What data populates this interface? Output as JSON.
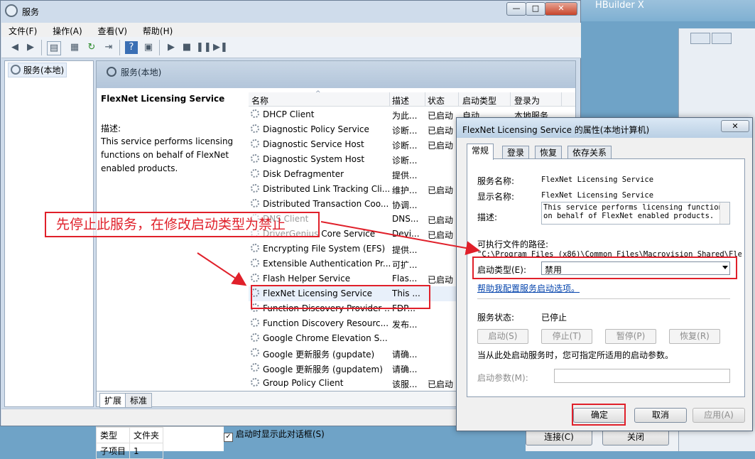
{
  "background": {
    "other_window_title": "HBuilder X",
    "bottom_buttons": {
      "connect": "连接(C)",
      "close": "关闭"
    },
    "checkbox_label": "启动时显示此对话框(S)",
    "mini_table": {
      "header": [
        "类型",
        "文件夹"
      ],
      "row": [
        "子项目",
        "1"
      ]
    }
  },
  "window": {
    "title": "服务",
    "controls": {
      "minimize": "—",
      "maximize": "□",
      "close": "✕"
    },
    "menu": [
      "文件(F)",
      "操作(A)",
      "查看(V)",
      "帮助(H)"
    ],
    "toolbar_icons": [
      "back-icon",
      "forward-icon",
      "console-tree-icon",
      "properties-icon",
      "refresh-icon",
      "export-icon",
      "help-icon",
      "view-icon",
      "start-icon",
      "stop-icon",
      "pause-icon",
      "restart-icon"
    ],
    "tree_item": "服务(本地)",
    "pane_header": "服务(本地)",
    "desc_title": "FlexNet Licensing Service",
    "desc_label": "描述:",
    "desc_text": "This service performs licensing functions on behalf of FlexNet enabled products.",
    "columns": [
      "名称",
      "描述",
      "状态",
      "启动类型",
      "登录为"
    ],
    "rows": [
      {
        "name": "DHCP Client",
        "desc": "为此...",
        "status": "已启动",
        "startup": "自动",
        "logon": "本地服务"
      },
      {
        "name": "Diagnostic Policy Service",
        "desc": "诊断...",
        "status": "已启动",
        "startup": "",
        "logon": ""
      },
      {
        "name": "Diagnostic Service Host",
        "desc": "诊断...",
        "status": "已启动",
        "startup": "",
        "logon": ""
      },
      {
        "name": "Diagnostic System Host",
        "desc": "诊断...",
        "status": "",
        "startup": "",
        "logon": ""
      },
      {
        "name": "Disk Defragmenter",
        "desc": "提供...",
        "status": "",
        "startup": "",
        "logon": ""
      },
      {
        "name": "Distributed Link Tracking Cli...",
        "desc": "维护...",
        "status": "已启动",
        "startup": "",
        "logon": ""
      },
      {
        "name": "Distributed Transaction Coo...",
        "desc": "协调...",
        "status": "",
        "startup": "",
        "logon": ""
      },
      {
        "name": "DNS Client",
        "desc": "DNS...",
        "status": "已启动",
        "startup": "",
        "logon": ""
      },
      {
        "name": "DriverGenius Core Service",
        "desc": "Devi...",
        "status": "已启动",
        "startup": "",
        "logon": ""
      },
      {
        "name": "Encrypting File System (EFS)",
        "desc": "提供...",
        "status": "",
        "startup": "",
        "logon": ""
      },
      {
        "name": "Extensible Authentication Pr...",
        "desc": "可扩...",
        "status": "",
        "startup": "",
        "logon": ""
      },
      {
        "name": "Flash Helper Service",
        "desc": "Flas...",
        "status": "已启动",
        "startup": "",
        "logon": ""
      },
      {
        "name": "FlexNet Licensing Service",
        "desc": "This ...",
        "status": "",
        "startup": "",
        "logon": ""
      },
      {
        "name": "Function Discovery Provider ...",
        "desc": "FDP...",
        "status": "",
        "startup": "",
        "logon": ""
      },
      {
        "name": "Function Discovery Resourc...",
        "desc": "发布...",
        "status": "",
        "startup": "",
        "logon": ""
      },
      {
        "name": "Google Chrome Elevation S...",
        "desc": "",
        "status": "",
        "startup": "",
        "logon": ""
      },
      {
        "name": "Google 更新服务 (gupdate)",
        "desc": "请确...",
        "status": "",
        "startup": "",
        "logon": ""
      },
      {
        "name": "Google 更新服务 (gupdatem)",
        "desc": "请确...",
        "status": "",
        "startup": "",
        "logon": ""
      },
      {
        "name": "Group Policy Client",
        "desc": "该服...",
        "status": "已启动",
        "startup": "",
        "logon": ""
      }
    ],
    "tabs": [
      "扩展",
      "标准"
    ]
  },
  "dialog": {
    "title": "FlexNet Licensing Service 的属性(本地计算机)",
    "close": "✕",
    "tabs": [
      "常规",
      "登录",
      "恢复",
      "依存关系"
    ],
    "service_name_label": "服务名称:",
    "service_name": "FlexNet Licensing Service",
    "display_name_label": "显示名称:",
    "display_name": "FlexNet Licensing Service",
    "description_label": "描述:",
    "description": "This service performs licensing functions on behalf of FlexNet enabled products.",
    "exe_path_label": "可执行文件的路径:",
    "exe_path": "\"C:\\Program Files (x86)\\Common Files\\Macrovision Shared\\Fle",
    "startup_type_label": "启动类型(E):",
    "startup_type_value": "禁用",
    "help_link": "帮助我配置服务启动选项。",
    "status_label": "服务状态:",
    "status_value": "已停止",
    "buttons_service": [
      "启动(S)",
      "停止(T)",
      "暂停(P)",
      "恢复(R)"
    ],
    "start_params_hint": "当从此处启动服务时，您可指定所适用的启动参数。",
    "start_params_label": "启动参数(M):",
    "ok": "确定",
    "cancel": "取消",
    "apply": "应用(A)"
  },
  "annotation": {
    "text": "先停止此服务，在修改启动类型为禁止",
    "color": "#e0202a"
  }
}
